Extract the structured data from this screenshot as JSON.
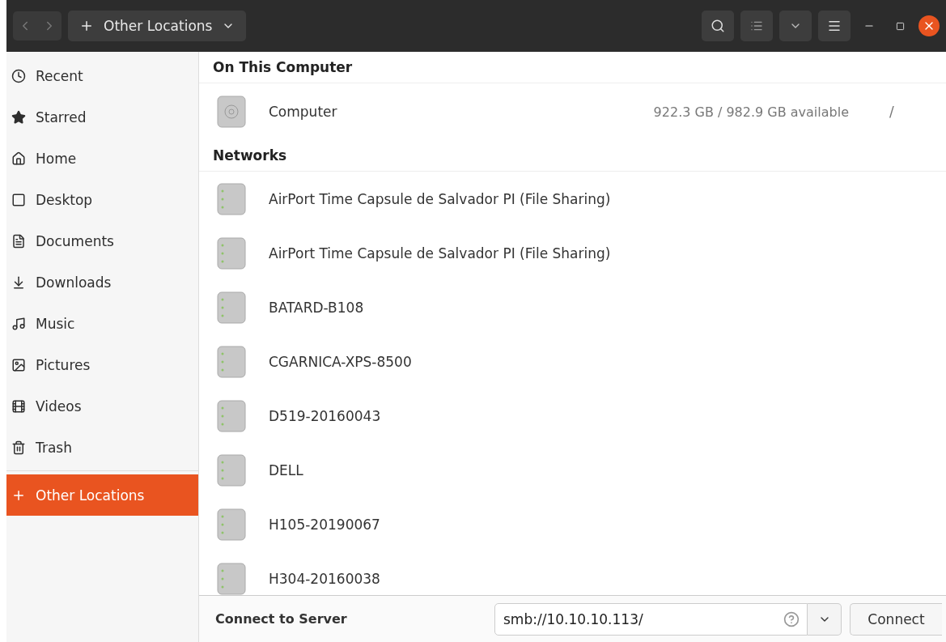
{
  "header": {
    "location": "Other Locations"
  },
  "sidebar": {
    "items": [
      {
        "label": "Recent",
        "kind": "recent",
        "selected": false
      },
      {
        "label": "Starred",
        "kind": "starred",
        "selected": false
      },
      {
        "label": "Home",
        "kind": "home",
        "selected": false
      },
      {
        "label": "Desktop",
        "kind": "desktop",
        "selected": false
      },
      {
        "label": "Documents",
        "kind": "documents",
        "selected": false
      },
      {
        "label": "Downloads",
        "kind": "downloads",
        "selected": false
      },
      {
        "label": "Music",
        "kind": "music",
        "selected": false
      },
      {
        "label": "Pictures",
        "kind": "pictures",
        "selected": false
      },
      {
        "label": "Videos",
        "kind": "videos",
        "selected": false
      },
      {
        "label": "Trash",
        "kind": "trash",
        "selected": false
      },
      {
        "label": "Other Locations",
        "kind": "other",
        "selected": true
      }
    ]
  },
  "on_this_computer": {
    "heading": "On This Computer",
    "items": [
      {
        "name": "Computer",
        "space": "922.3 GB / 982.9 GB available",
        "mount": "/"
      }
    ]
  },
  "networks": {
    "heading": "Networks",
    "items": [
      {
        "name": "AirPort Time Capsule de Salvador PI (File Sharing)"
      },
      {
        "name": "AirPort Time Capsule de Salvador PI (File Sharing)"
      },
      {
        "name": "BATARD-B108"
      },
      {
        "name": "CGARNICA-XPS-8500"
      },
      {
        "name": "D519-20160043"
      },
      {
        "name": "DELL"
      },
      {
        "name": "H105-20190067"
      },
      {
        "name": "H304-20160038"
      }
    ]
  },
  "connect": {
    "label": "Connect to Server",
    "value": "smb://10.10.10.113/",
    "button": "Connect"
  }
}
